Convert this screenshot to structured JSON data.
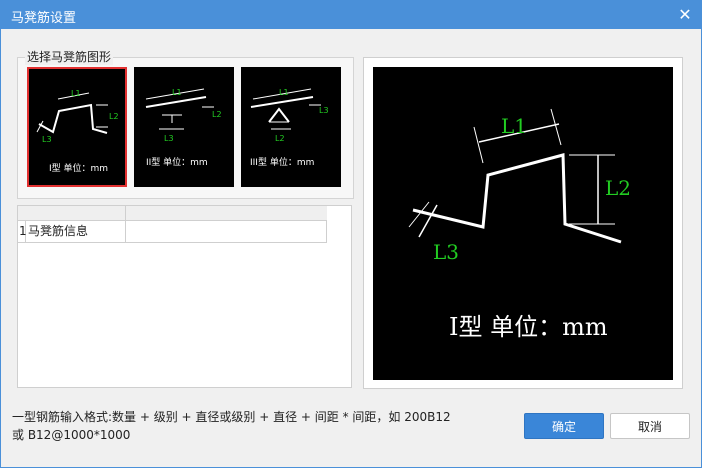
{
  "window": {
    "title": "马凳筋设置",
    "close_glyph": "✕"
  },
  "group": {
    "label": "选择马凳筋图形"
  },
  "shapes": [
    {
      "caption": "I型 单位：mm",
      "labels": [
        "L1",
        "L2",
        "L3"
      ],
      "selected": true
    },
    {
      "caption": "II型 单位：mm",
      "labels": [
        "L1",
        "L2",
        "L3"
      ],
      "selected": false
    },
    {
      "caption": "III型 单位：mm",
      "labels": [
        "L1",
        "L2",
        "L3"
      ],
      "selected": false
    }
  ],
  "grid": {
    "rows": [
      {
        "index": "1",
        "name": "马凳筋信息",
        "value": ""
      }
    ]
  },
  "preview": {
    "caption": "I型 单位：mm",
    "labels": [
      "L1",
      "L2",
      "L3"
    ]
  },
  "help": {
    "line1": "一型钢筋输入格式:数量 + 级别 + 直径或级别 + 直径 + 间距 * 间距，如 200B12",
    "line2": "或 B12@1000*1000"
  },
  "buttons": {
    "ok": "确定",
    "cancel": "取消"
  },
  "colors": {
    "accent": "#4a90d9",
    "dimension": "#22cc22",
    "selected_border": "#e23030"
  },
  "icons": {
    "close": "close-icon"
  }
}
